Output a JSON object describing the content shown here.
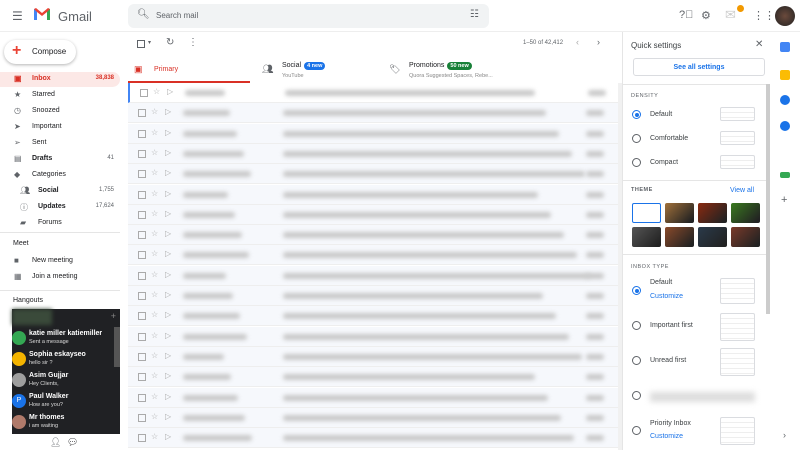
{
  "header": {
    "brand": "Gmail",
    "search_placeholder": "Search mail",
    "notification_count": "1"
  },
  "sidebar": {
    "compose": "Compose",
    "items": [
      {
        "label": "Inbox",
        "count": "38,838",
        "icon": "inbox-icon",
        "active": true
      },
      {
        "label": "Starred",
        "count": "",
        "icon": "star-icon"
      },
      {
        "label": "Snoozed",
        "count": "",
        "icon": "clock-icon"
      },
      {
        "label": "Important",
        "count": "",
        "icon": "important-icon"
      },
      {
        "label": "Sent",
        "count": "",
        "icon": "send-icon"
      },
      {
        "label": "Drafts",
        "count": "41",
        "icon": "draft-icon",
        "bold": true
      },
      {
        "label": "Categories",
        "count": "",
        "icon": "label-icon"
      },
      {
        "label": "Social",
        "count": "1,755",
        "icon": "people-icon",
        "bold": true,
        "sub": true
      },
      {
        "label": "Updates",
        "count": "17,624",
        "icon": "info-icon",
        "bold": true,
        "sub": true
      },
      {
        "label": "Forums",
        "count": "",
        "icon": "forum-icon",
        "sub": true
      }
    ],
    "meet": {
      "title": "Meet",
      "new_meeting": "New meeting",
      "join_meeting": "Join a meeting"
    },
    "hangouts": {
      "title": "Hangouts",
      "contacts": [
        {
          "name": "katie miller katiemiller",
          "message": "Sent a message",
          "color": "#34a853"
        },
        {
          "name": "Sophia eskayseo",
          "message": "hello sir ?",
          "color": "#f4b400"
        },
        {
          "name": "Asim Gujjar",
          "message": "Hey Clients,",
          "color": "#9e9e9e"
        },
        {
          "name": "Paul Walker",
          "message": "How are you?",
          "color": "#1a73e8",
          "initial": "P"
        },
        {
          "name": "Mr thomes",
          "message": "i am waiting",
          "color": "#b07a6a"
        }
      ]
    }
  },
  "toolbar": {
    "pagination": "1–50 of 42,412"
  },
  "tabs": [
    {
      "label": "Primary",
      "sub": "",
      "badge": ""
    },
    {
      "label": "Social",
      "sub": "YouTube",
      "badge": "4 new",
      "badge_color": "#1a73e8"
    },
    {
      "label": "Promotions",
      "sub": "Quora Suggested Spaces, Rebe...",
      "badge": "50 new",
      "badge_color": "#188038"
    }
  ],
  "quick_settings": {
    "title": "Quick settings",
    "see_all": "See all settings",
    "density_title": "DENSITY",
    "density": [
      "Default",
      "Comfortable",
      "Compact"
    ],
    "theme_title": "THEME",
    "view_all": "View all",
    "inbox_type_title": "INBOX TYPE",
    "inbox_types": [
      "Default",
      "Important first",
      "Unread first",
      "Priority Inbox"
    ],
    "customize": "Customize"
  },
  "colors": {
    "accent": "#1a73e8",
    "inbox_red": "#d93025"
  }
}
